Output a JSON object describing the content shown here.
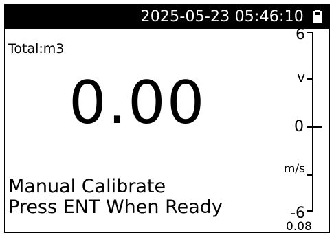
{
  "status": {
    "datetime": "2025-05-23 05:46:10",
    "battery_icon": "battery-icon"
  },
  "total_label": "Total:m3",
  "main_value": "0.00",
  "message": {
    "line1": "Manual Calibrate",
    "line2": "Press ENT When Ready"
  },
  "scale": {
    "max_label": "6",
    "upper_unit": "v",
    "zero_label": "0",
    "lower_unit": "m/s",
    "min_label": "-6",
    "current_value": "0.08",
    "indicator_level": 0
  }
}
